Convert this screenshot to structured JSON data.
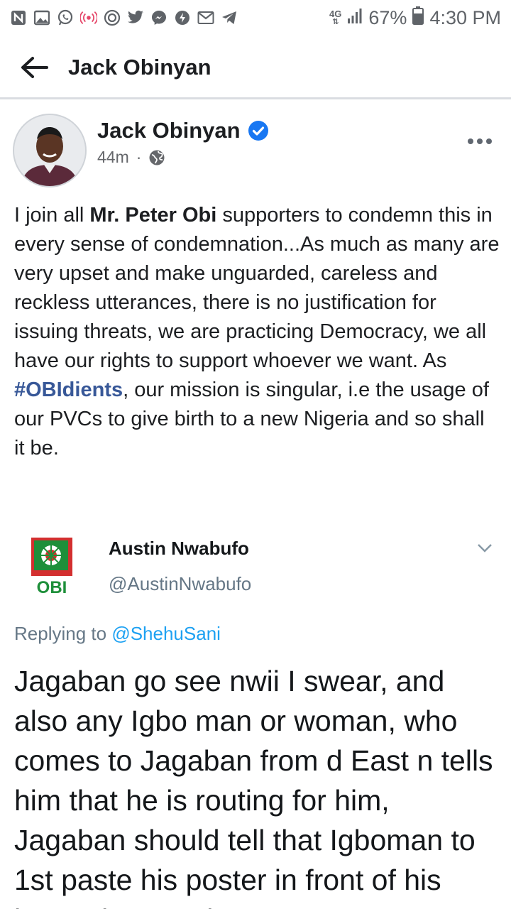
{
  "status_bar": {
    "network": "4G",
    "battery": "67%",
    "time": "4:30 PM",
    "notification_icons": [
      "n-icon",
      "gallery-icon",
      "whatsapp-icon",
      "radio-icon",
      "sync-icon",
      "twitter-icon",
      "messenger-icon",
      "bolt-icon",
      "gmail-icon",
      "telegram-icon"
    ]
  },
  "header": {
    "title": "Jack Obinyan"
  },
  "post": {
    "author": "Jack Obinyan",
    "time": "44m",
    "separator": "·",
    "text_1": "I join all ",
    "text_bold": "Mr. Peter Obi",
    "text_2": " supporters to condemn this in every sense of condemnation...As much as many are very upset and make unguarded, careless and reckless utterances, there is no justification for issuing threats, we are practicing Democracy, we all have our rights to support whoever we want. As ",
    "hashtag": "#OBIdients",
    "text_3": ", our mission is singular, i.e the usage of our PVCs to give birth to a new Nigeria and so shall it be."
  },
  "tweet": {
    "logo_text": "OBI",
    "name": "Austin Nwabufo",
    "handle": "@AustinNwabufo",
    "replying_prefix": "Replying to ",
    "replying_to": "@ShehuSani",
    "text": "Jagaban go see nwii I swear, and also any Igbo man or woman, who comes to Jagaban from d East n tells him that he is routing for him, Jagaban should tell that Igboman to 1st paste his poster in front of his house in Anambra"
  },
  "colors": {
    "link": "#385898",
    "twitter_blue": "#1da1f2",
    "verified": "#1877f2",
    "logo_red": "#d32f2f",
    "logo_green": "#1e8f3a"
  }
}
